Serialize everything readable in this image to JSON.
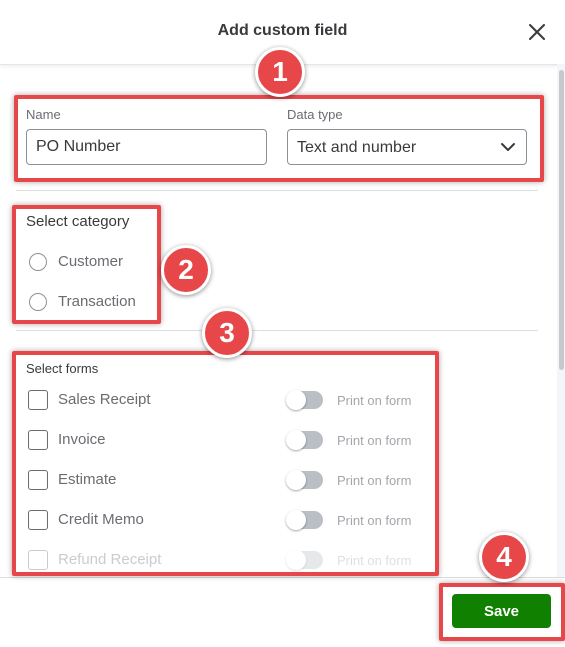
{
  "dialog": {
    "title": "Add custom field"
  },
  "name_field": {
    "label": "Name",
    "value": "PO Number"
  },
  "data_type": {
    "label": "Data type",
    "selected": "Text and number"
  },
  "category": {
    "heading": "Select category",
    "options": [
      {
        "label": "Customer",
        "selected": false
      },
      {
        "label": "Transaction",
        "selected": false
      }
    ]
  },
  "forms": {
    "heading": "Select forms",
    "print_label": "Print on form",
    "items": [
      {
        "label": "Sales Receipt",
        "checked": false,
        "print_on": false
      },
      {
        "label": "Invoice",
        "checked": false,
        "print_on": false
      },
      {
        "label": "Estimate",
        "checked": false,
        "print_on": false
      },
      {
        "label": "Credit Memo",
        "checked": false,
        "print_on": false
      },
      {
        "label": "Refund Receipt",
        "checked": false,
        "print_on": false
      }
    ]
  },
  "footer": {
    "save_label": "Save"
  },
  "callouts": [
    "1",
    "2",
    "3",
    "4"
  ],
  "colors": {
    "accent_red": "#e8474a",
    "save_green": "#108000"
  },
  "icons": {
    "close": "close-icon",
    "dropdown": "chevron-down-icon"
  }
}
